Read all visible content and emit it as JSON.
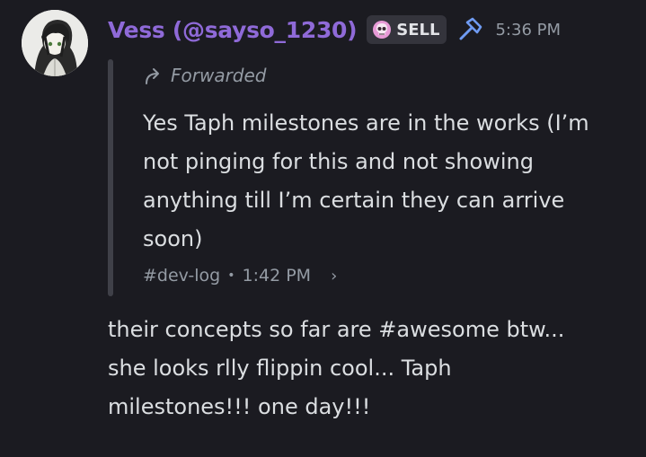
{
  "message": {
    "author": "Vess (@sayso_1230)",
    "role_tag": {
      "icon": "skull-icon",
      "label": "SELL"
    },
    "badge_icon": "hammer-icon",
    "timestamp": "5:36 PM",
    "forward": {
      "label": "Forwarded",
      "text": "Yes Taph milestones are in the works (I’m\nnot pinging for this and not showing\nanything till I’m certain they can arrive\nsoon)",
      "channel": "#dev-log",
      "time": "1:42 PM"
    },
    "text": "their concepts so far are #awesome btw...\nshe looks rlly flippin cool... Taph\nmilestones!!! one day!!!"
  },
  "colors": {
    "background": "#1b1b21",
    "username": "#8f6ad8",
    "muted": "#949ba4",
    "body_text": "#dbdee1",
    "tag_bg": "#34343c",
    "skull": "#e79ad6",
    "hammer": "#6f9bf2"
  }
}
